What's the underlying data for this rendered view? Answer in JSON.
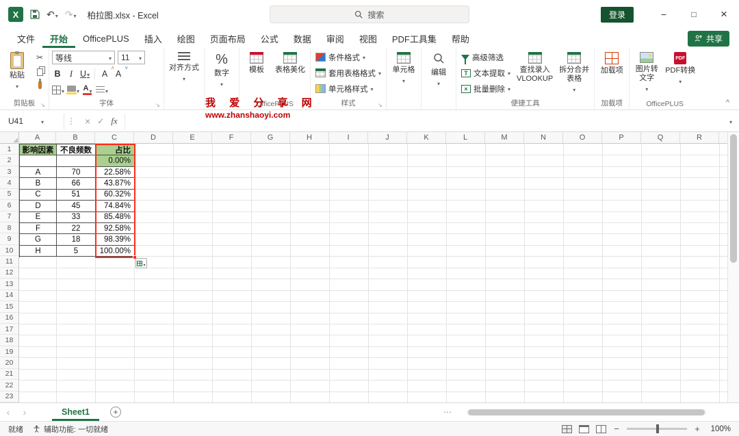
{
  "colors": {
    "accent": "#217346",
    "header_fill": "#A9D08E",
    "range_border": "#FF2B1A",
    "watermark": "#C00000"
  },
  "titlebar": {
    "filename": "柏拉图.xlsx - Excel",
    "search_placeholder": "搜索",
    "login_label": "登录"
  },
  "ribbon_tabs": {
    "items": [
      {
        "label": "文件"
      },
      {
        "label": "开始"
      },
      {
        "label": "OfficePLUS"
      },
      {
        "label": "插入"
      },
      {
        "label": "绘图"
      },
      {
        "label": "页面布局"
      },
      {
        "label": "公式"
      },
      {
        "label": "数据"
      },
      {
        "label": "审阅"
      },
      {
        "label": "视图"
      },
      {
        "label": "PDF工具集"
      },
      {
        "label": "帮助"
      }
    ],
    "active": "开始",
    "share_label": "共享"
  },
  "ribbon": {
    "clipboard": {
      "paste": "粘贴",
      "group": "剪贴板"
    },
    "font": {
      "name": "等线",
      "size": "11",
      "bold": "B",
      "italic": "I",
      "underline": "U",
      "grow": "A",
      "shrink": "A",
      "group": "字体"
    },
    "alignment": {
      "label": "对齐方式"
    },
    "number": {
      "label": "数字"
    },
    "officeplus_left": {
      "template": "模板",
      "beautify": "表格美化",
      "group": "OfficePLUS"
    },
    "styles": {
      "conditional": "条件格式",
      "table_style": "套用表格格式",
      "cell_style": "单元格样式",
      "group": "样式"
    },
    "cells": {
      "label": "单元格"
    },
    "editing": {
      "label": "编辑"
    },
    "tools": {
      "advanced_filter": "高级筛选",
      "text_extract": "文本提取",
      "batch_delete": "批量删除",
      "vlookup": "查找录入\nVLOOKUP",
      "split_merge": "拆分合并\n表格",
      "group": "便捷工具"
    },
    "addins": {
      "label": "加载项",
      "group": "加载项"
    },
    "officeplus_right": {
      "img_to_text": "图片转\n文字",
      "pdf_convert": "PDF转换",
      "group": "OfficePLUS"
    }
  },
  "watermark": {
    "line1": "我 爱 分 享 网",
    "line2": "www.zhanshaoyi.com"
  },
  "formula_bar": {
    "name_box": "U41",
    "fx_label": "fx",
    "value": ""
  },
  "grid": {
    "columns": [
      "A",
      "B",
      "C",
      "D",
      "E",
      "F",
      "G",
      "H",
      "I",
      "J",
      "K",
      "L",
      "M",
      "N",
      "O",
      "P",
      "Q",
      "R"
    ],
    "row_count": 23,
    "table": {
      "headers": [
        "影响因素",
        "不良频数",
        "占比"
      ],
      "body": [
        [
          "",
          "",
          "0.00%"
        ],
        [
          "A",
          "70",
          "22.58%"
        ],
        [
          "B",
          "66",
          "43.87%"
        ],
        [
          "C",
          "51",
          "60.32%"
        ],
        [
          "D",
          "45",
          "74.84%"
        ],
        [
          "E",
          "33",
          "85.48%"
        ],
        [
          "F",
          "22",
          "92.58%"
        ],
        [
          "G",
          "18",
          "98.39%"
        ],
        [
          "H",
          "5",
          "100.00%"
        ]
      ],
      "selected_range": "C1:C10"
    }
  },
  "sheet_bar": {
    "sheet": "Sheet1"
  },
  "status_bar": {
    "ready": "就绪",
    "accessibility": "辅助功能: 一切就绪",
    "zoom": "100%"
  }
}
